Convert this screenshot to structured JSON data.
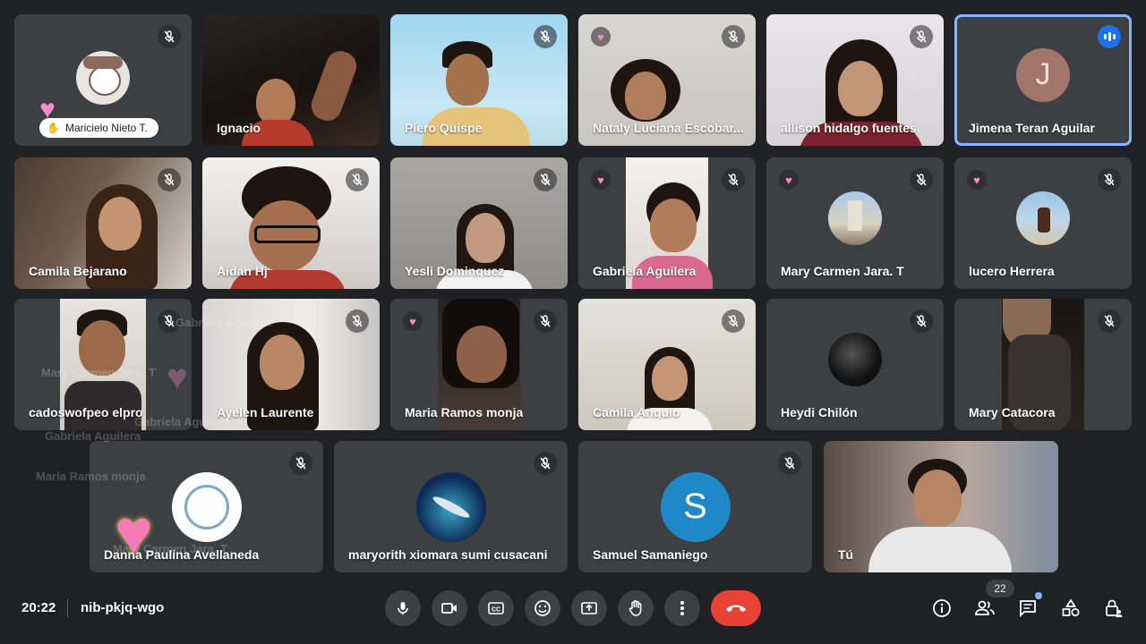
{
  "meeting": {
    "time": "20:22",
    "code": "nib-pkjq-wgo",
    "participant_count": "22"
  },
  "participants": [
    {
      "name": "Maricielo Nieto T.",
      "hand_raised": true
    },
    {
      "name": "Ignacio"
    },
    {
      "name": "Piero Quispe"
    },
    {
      "name": "Nataly Luciana Escobar..."
    },
    {
      "name": "allison hidalgo fuentes"
    },
    {
      "name": "Jimena Teran Aguilar",
      "avatar_letter": "J",
      "speaking": true
    },
    {
      "name": "Camila Bejarano"
    },
    {
      "name": "Aidan Hj"
    },
    {
      "name": "Yesli Dominguez"
    },
    {
      "name": "Gabriela Aguilera"
    },
    {
      "name": "Mary Carmen Jara. T"
    },
    {
      "name": "lucero Herrera"
    },
    {
      "name": "cadoswofpeo elpro"
    },
    {
      "name": "Ayelen Laurente"
    },
    {
      "name": "Maria Ramos monja"
    },
    {
      "name": "Camila Angulo"
    },
    {
      "name": "Heydi Chilón"
    },
    {
      "name": "Mary Catacora"
    },
    {
      "name": "Danna Paulina Avellaneda"
    },
    {
      "name": "maryorith xiomara sumi cusacani"
    },
    {
      "name": "Samuel Samaniego",
      "avatar_letter": "S"
    },
    {
      "name": "Tú"
    }
  ],
  "reaction_labels": {
    "a": "Gabriela Aguilera",
    "b": "Mary Carmen Jara. T",
    "c": "Gabriela Aguilera",
    "d": "Gabriela Aguilera",
    "e": "Maria Ramos monja",
    "f": "Mary Carmen Jara. T"
  },
  "colors": {
    "background": "#202124",
    "tile": "#3c4043",
    "accent": "#1a73e8",
    "end_call": "#ea4335",
    "reaction": "#f28bc7"
  }
}
